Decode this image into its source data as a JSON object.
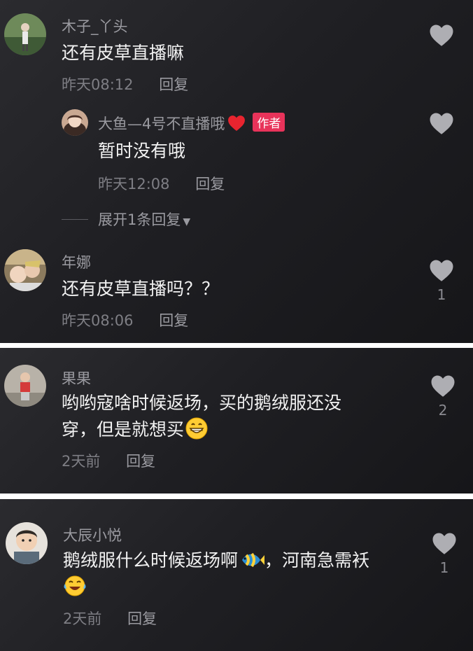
{
  "colors": {
    "background": "#1c1c20",
    "author_badge": "#e8335a",
    "heart_icon": "#aeaeb3"
  },
  "comments": [
    {
      "username": "木子_丫头",
      "text": "还有皮草直播嘛",
      "time": "昨天08:12",
      "reply_label": "回复",
      "like_count": "",
      "avatar_icon": "avatar-photo-icon",
      "replies": [
        {
          "username": "大鱼—4号不直播哦",
          "badge": "作者",
          "text": "暂时没有哦",
          "time": "昨天12:08",
          "reply_label": "回复",
          "like_count": "",
          "avatar_icon": "avatar-photo-icon"
        }
      ],
      "expand_label": "展开1条回复"
    },
    {
      "username": "年娜",
      "text": "还有皮草直播吗？？",
      "time": "昨天08:06",
      "reply_label": "回复",
      "like_count": "1",
      "avatar_icon": "avatar-photo-icon"
    },
    {
      "username": "果果",
      "text_line1": "哟哟寇啥时候返场，买的鹅绒服还没",
      "text_line2": "穿，但是就想买",
      "emoji": "grin-emoji-icon",
      "time": "2天前",
      "reply_label": "回复",
      "like_count": "2",
      "avatar_icon": "avatar-photo-icon"
    },
    {
      "username": "大辰小悦",
      "text_line1a": "鹅绒服什么时候返场啊",
      "emoji1": "fish-emoji-icon",
      "text_line1b": "，河南急需袄",
      "emoji2": "laugh-cry-emoji-icon",
      "time": "2天前",
      "reply_label": "回复",
      "like_count": "1",
      "avatar_icon": "avatar-photo-icon"
    }
  ]
}
